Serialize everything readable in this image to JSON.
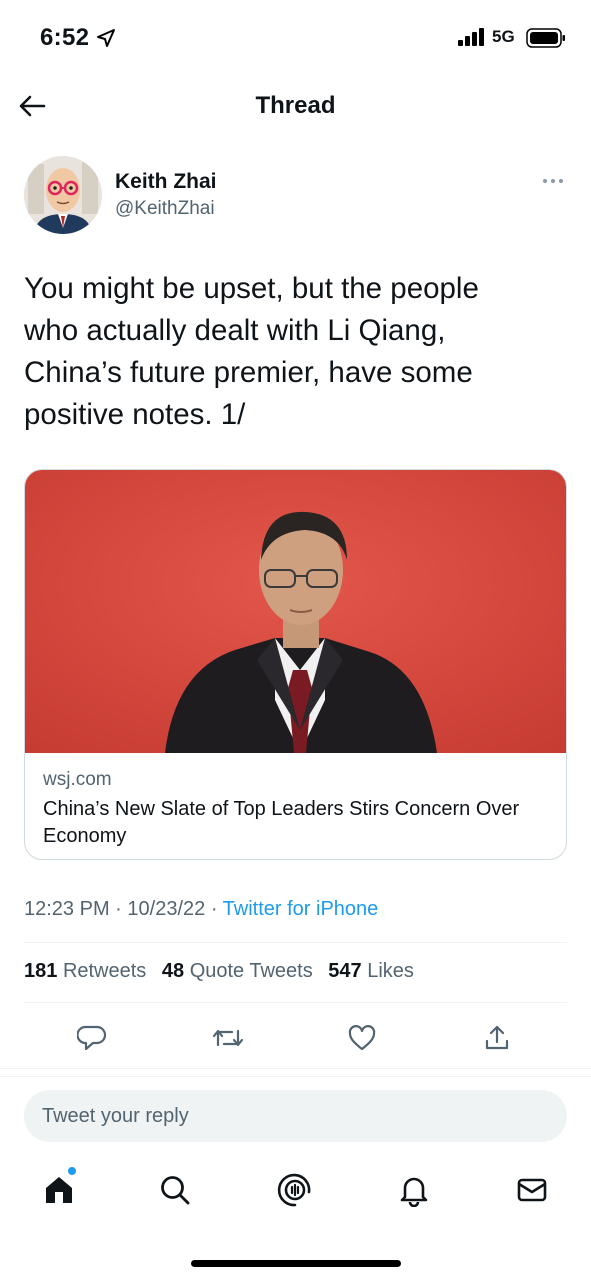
{
  "status_bar": {
    "time": "6:52",
    "network": "5G"
  },
  "header": {
    "title": "Thread"
  },
  "tweet": {
    "author_name": "Keith Zhai",
    "author_handle": "@KeithZhai",
    "text": "You might be upset, but the people\nwho actually dealt with Li Qiang,\nChina’s future premier, have some\npositive notes. 1/",
    "card": {
      "domain": "wsj.com",
      "title": "China’s New Slate of Top Leaders Stirs Concern Over Economy"
    },
    "time": "12:23 PM",
    "date": "10/23/22",
    "source": "Twitter for iPhone",
    "stats": {
      "retweets_count": "181",
      "retweets_label": "Retweets",
      "quotes_count": "48",
      "quotes_label": "Quote Tweets",
      "likes_count": "547",
      "likes_label": "Likes"
    }
  },
  "reply": {
    "placeholder": "Tweet your reply"
  },
  "colors": {
    "accent": "#1d9bf0",
    "text": "#0f1419",
    "secondary": "#536471",
    "card_bg": "#d9483e"
  },
  "icons": {
    "status": [
      "location-arrow-icon",
      "signal-icon",
      "battery-icon"
    ],
    "actions": [
      "reply-icon",
      "retweet-icon",
      "like-icon",
      "share-icon"
    ],
    "tabs": [
      "home-icon",
      "search-icon",
      "spaces-icon",
      "notifications-icon",
      "messages-icon"
    ]
  }
}
